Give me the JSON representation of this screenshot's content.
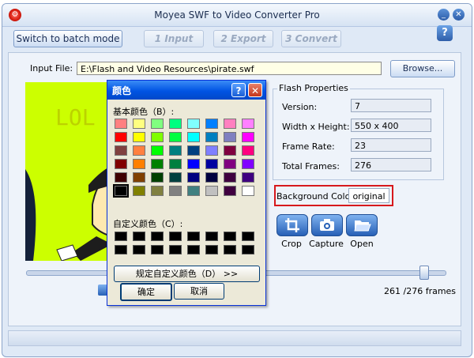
{
  "app": {
    "title": "Moyea SWF to Video Converter Pro",
    "minimize_glyph": "_",
    "close_glyph": "✕"
  },
  "toolbar": {
    "batch_mode": "Switch to batch mode",
    "steps": [
      {
        "num": "1",
        "label": "Input"
      },
      {
        "num": "2",
        "label": "Export"
      },
      {
        "num": "3",
        "label": "Convert"
      }
    ],
    "help": "?"
  },
  "input": {
    "label": "Input File:",
    "value": "E:\\Flash and Video Resources\\pirate.swf",
    "browse": "Browse..."
  },
  "preview": {
    "overlay_text": "LOL"
  },
  "flash_properties": {
    "title": "Flash Properties",
    "rows": [
      {
        "label": "Version:",
        "value": "7"
      },
      {
        "label": "Width x Height:",
        "value": "550 x 400"
      },
      {
        "label": "Frame Rate:",
        "value": "23"
      },
      {
        "label": "Total Frames:",
        "value": "276"
      }
    ],
    "background_label": "Background Color:",
    "background_value": "original"
  },
  "tools": [
    {
      "label": "Crop",
      "icon": "crop-icon"
    },
    {
      "label": "Capture",
      "icon": "camera-icon"
    },
    {
      "label": "Open",
      "icon": "folder-icon"
    }
  ],
  "playback": {
    "frames": "261 /276 frames",
    "progress_fraction": 0.945
  },
  "color_dialog": {
    "title": "颜色",
    "help": "?",
    "close": "✕",
    "basic_label": "基本颜色（B）:",
    "custom_label": "自定义颜色（C）:",
    "define_button": "规定自定义颜色（D） >>",
    "ok": "确定",
    "cancel": "取消",
    "basic_colors": [
      [
        "#ff8080",
        "#ffff80",
        "#80ff80",
        "#00ff80",
        "#80ffff",
        "#0080ff",
        "#ff80c0",
        "#ff80ff"
      ],
      [
        "#ff0000",
        "#ffff00",
        "#80ff00",
        "#00ff40",
        "#00ffff",
        "#0080c0",
        "#8080c0",
        "#ff00ff"
      ],
      [
        "#804040",
        "#ff8040",
        "#00ff00",
        "#008080",
        "#004080",
        "#8080ff",
        "#800040",
        "#ff0080"
      ],
      [
        "#800000",
        "#ff8000",
        "#008000",
        "#008040",
        "#0000ff",
        "#0000a0",
        "#800080",
        "#8000ff"
      ],
      [
        "#400000",
        "#804000",
        "#004000",
        "#004040",
        "#000080",
        "#000040",
        "#400040",
        "#400080"
      ],
      [
        "#000000",
        "#808000",
        "#808040",
        "#808080",
        "#408080",
        "#c0c0c0",
        "#400040",
        "#ffffff"
      ]
    ]
  }
}
